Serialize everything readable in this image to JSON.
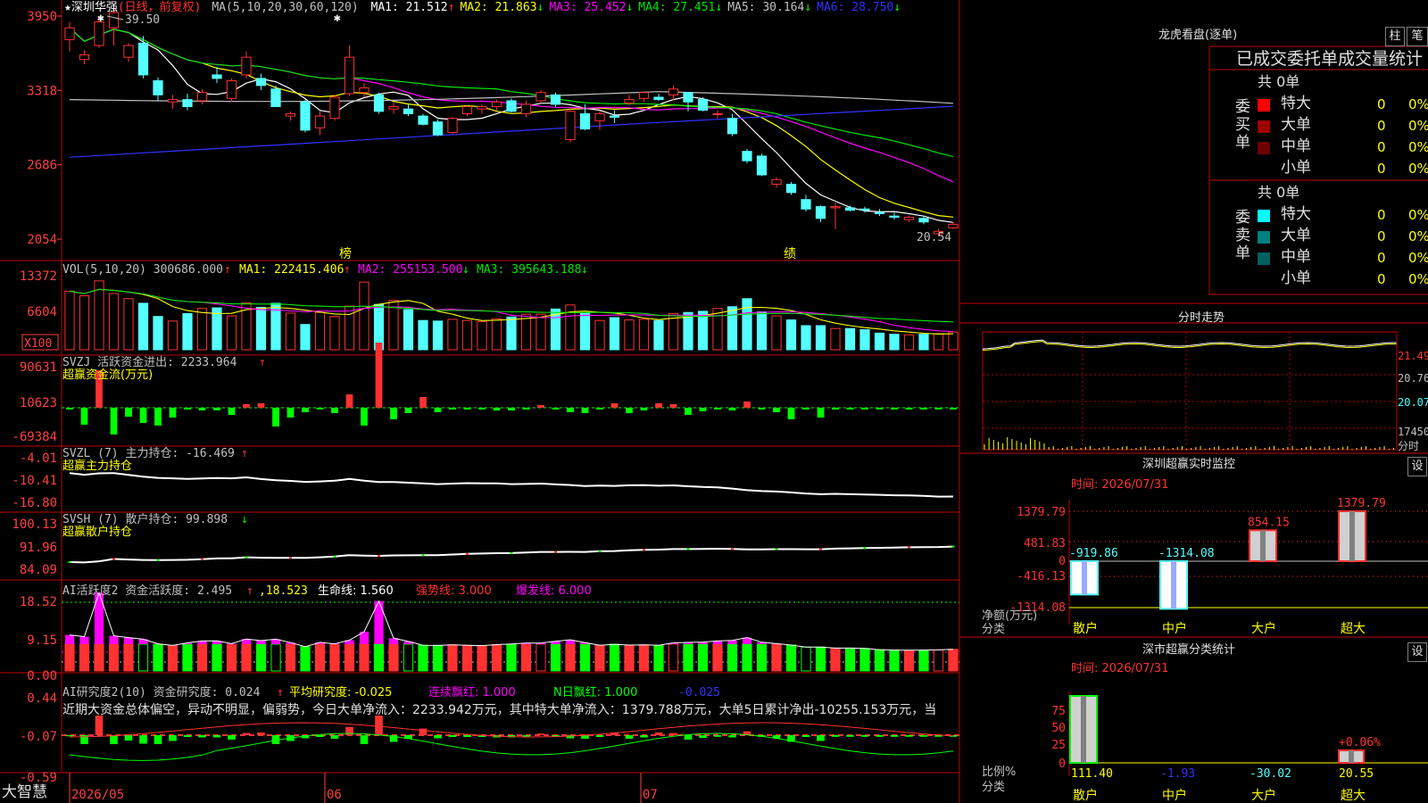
{
  "colors": {
    "up": "#ff3232",
    "down": "#54ffff",
    "ma1": "#ffffff",
    "ma2": "#ffff00",
    "ma3": "#ff00ff",
    "ma4": "#00e600",
    "ma5": "#c0c0c0",
    "ma6": "#3232ff",
    "border": "#c00000",
    "axis": "#ff4040",
    "yellow": "#ffff00",
    "green": "#00ff00"
  },
  "main": {
    "title": "★深圳华强",
    "subtitle": "(日线，前复权)",
    "ma_label": "MA(5,10,20,30,60,120)",
    "ma": [
      {
        "label": "MA1: 21.512",
        "arrow": "↑",
        "color": "#ffffff"
      },
      {
        "label": "MA2: 21.863",
        "arrow": "↓",
        "color": "#ffff00"
      },
      {
        "label": "MA3: 25.452",
        "arrow": "↓",
        "color": "#ff00ff"
      },
      {
        "label": "MA4: 27.451",
        "arrow": "↓",
        "color": "#00e600"
      },
      {
        "label": "MA5: 30.164",
        "arrow": "↓",
        "color": "#c0c0c0"
      },
      {
        "label": "MA6: 28.750",
        "arrow": "↓",
        "color": "#3232ff"
      }
    ],
    "y_ticks": [
      "3950",
      "3318",
      "2686",
      "2054"
    ],
    "high_label": "39.50",
    "low_label": "20.54",
    "markers": [
      "榜",
      "绩"
    ],
    "star_marks": [
      "✱",
      "✱"
    ]
  },
  "chart_data": [
    {
      "type": "candlestick",
      "title": "★深圳华强(日线，前复权)",
      "ylim": [
        1900,
        4000
      ],
      "y_ticks": [
        3950,
        3318,
        2686,
        2054
      ],
      "x_ticks": [
        "2026/05",
        "06",
        "07"
      ],
      "ohlc": [
        [
          3750,
          3900,
          3650,
          3850
        ],
        [
          3580,
          3660,
          3540,
          3620
        ],
        [
          3700,
          3950,
          3680,
          3900
        ],
        [
          3850,
          4020,
          3700,
          3980
        ],
        [
          3600,
          3720,
          3560,
          3700
        ],
        [
          3720,
          3780,
          3420,
          3450
        ],
        [
          3400,
          3430,
          3230,
          3280
        ],
        [
          3220,
          3280,
          3160,
          3240
        ],
        [
          3240,
          3290,
          3150,
          3180
        ],
        [
          3230,
          3330,
          3200,
          3300
        ],
        [
          3450,
          3520,
          3380,
          3420
        ],
        [
          3250,
          3420,
          3220,
          3400
        ],
        [
          3450,
          3650,
          3420,
          3600
        ],
        [
          3420,
          3460,
          3320,
          3360
        ],
        [
          3330,
          3360,
          3180,
          3180
        ],
        [
          3100,
          3140,
          3060,
          3120
        ],
        [
          3220,
          3240,
          2960,
          2980
        ],
        [
          3000,
          3140,
          2940,
          3100
        ],
        [
          3080,
          3280,
          3060,
          3260
        ],
        [
          3290,
          3700,
          3270,
          3600
        ],
        [
          3300,
          3380,
          3260,
          3340
        ],
        [
          3280,
          3300,
          3120,
          3140
        ],
        [
          3160,
          3220,
          3120,
          3180
        ],
        [
          3160,
          3200,
          3100,
          3120
        ],
        [
          3100,
          3120,
          3020,
          3030
        ],
        [
          3050,
          3070,
          2930,
          2940
        ],
        [
          2960,
          3090,
          2950,
          3080
        ],
        [
          3120,
          3190,
          3100,
          3180
        ],
        [
          3160,
          3200,
          3120,
          3180
        ],
        [
          3180,
          3240,
          3150,
          3220
        ],
        [
          3230,
          3250,
          3130,
          3140
        ],
        [
          3120,
          3230,
          3090,
          3200
        ],
        [
          3230,
          3320,
          3210,
          3300
        ],
        [
          3280,
          3300,
          3180,
          3200
        ],
        [
          2900,
          3160,
          2880,
          3140
        ],
        [
          3120,
          3200,
          2980,
          2990
        ],
        [
          3060,
          3140,
          2980,
          3120
        ],
        [
          3100,
          3150,
          3040,
          3090
        ],
        [
          3210,
          3280,
          3190,
          3240
        ],
        [
          3250,
          3310,
          3220,
          3300
        ],
        [
          3260,
          3290,
          3230,
          3240
        ],
        [
          3280,
          3360,
          3230,
          3330
        ],
        [
          3300,
          3260,
          3140,
          3220
        ],
        [
          3240,
          3260,
          3140,
          3150
        ],
        [
          3120,
          3150,
          3080,
          3120
        ],
        [
          3080,
          3120,
          2930,
          2950
        ],
        [
          2800,
          2820,
          2700,
          2720
        ],
        [
          2760,
          2780,
          2590,
          2600
        ],
        [
          2520,
          2580,
          2490,
          2560
        ],
        [
          2520,
          2540,
          2430,
          2450
        ],
        [
          2390,
          2430,
          2290,
          2310
        ],
        [
          2330,
          2340,
          2200,
          2230
        ],
        [
          2320,
          2360,
          2140,
          2330
        ],
        [
          2320,
          2340,
          2290,
          2300
        ],
        [
          2310,
          2330,
          2280,
          2300
        ],
        [
          2280,
          2310,
          2250,
          2270
        ],
        [
          2250,
          2280,
          2220,
          2240
        ],
        [
          2220,
          2250,
          2200,
          2240
        ],
        [
          2230,
          2250,
          2180,
          2200
        ],
        [
          2100,
          2140,
          2080,
          2120
        ],
        [
          2150,
          2200,
          2140,
          2180
        ]
      ]
    },
    {
      "type": "bar",
      "title": "VOL(5,10,20)",
      "ylim": [
        0,
        13372
      ],
      "values": [
        10200,
        9400,
        12000,
        9800,
        8900,
        8100,
        5800,
        5000,
        6300,
        7200,
        7300,
        5900,
        8200,
        7400,
        8100,
        6400,
        4400,
        6500,
        5800,
        7600,
        11800,
        7900,
        8600,
        7000,
        5100,
        5000,
        5300,
        5100,
        4900,
        5400,
        5700,
        6200,
        6200,
        7100,
        7800,
        6400,
        5100,
        5600,
        5200,
        5300,
        5100,
        6300,
        6500,
        6700,
        7200,
        7500,
        8900,
        6600,
        5900,
        5200,
        4200,
        4200,
        3700,
        3700,
        3500,
        2900,
        2700,
        2600,
        2700,
        2800,
        3100
      ]
    },
    {
      "type": "bar",
      "title": "超赢资金流(万元)",
      "ylim": [
        -69384,
        90631
      ],
      "values": [
        -500,
        -19000,
        42000,
        -30000,
        -10000,
        -17000,
        -20000,
        -11000,
        -2000,
        -3000,
        -3000,
        -8000,
        4000,
        5000,
        -21000,
        -11000,
        -5000,
        -2000,
        -6000,
        15000,
        -20000,
        73000,
        -13000,
        -6000,
        12000,
        -5000,
        -2000,
        -2000,
        -2000,
        -3000,
        -3000,
        -2000,
        3000,
        -2000,
        -5000,
        -6000,
        -2000,
        5000,
        -6000,
        -3000,
        5000,
        4000,
        -8000,
        -4000,
        -1500,
        -3000,
        7000,
        -1500,
        -5000,
        -13000,
        -2000,
        -11000,
        -1500,
        -1500,
        -1500,
        -1500,
        -1500,
        -1500,
        -1500,
        -1500,
        -1500
      ]
    }
  ],
  "panels": {
    "vol": {
      "text": "VOL(5,10,20) 300686.000",
      "arrow": "↑",
      "ma": [
        {
          "label": "MA1: 222415.406",
          "arrow": "↑",
          "color": "#ffff00"
        },
        {
          "label": "MA2: 255153.500",
          "arrow": "↓",
          "color": "#ff00ff"
        },
        {
          "label": "MA3: 395643.188",
          "arrow": "↓",
          "color": "#00e600"
        }
      ],
      "y_ticks": [
        "13372",
        "6604"
      ],
      "unit": "X100"
    },
    "svzj": {
      "text": "SVZJ  活跃资金进出: 2233.964",
      "arrow": "↑",
      "sub": "超赢资金流(万元)",
      "y_ticks": [
        "90631",
        "10623",
        "-69384"
      ]
    },
    "svzl": {
      "text": "SVZL (7) 主力持仓: -16.469",
      "arrow": "↑",
      "sub": "超赢主力持仓",
      "y_ticks": [
        "-4.01",
        "-10.41",
        "-16.80"
      ]
    },
    "svsh": {
      "text": "SVSH (7) 散户持仓: 99.898",
      "arrow": "↓",
      "sub": "超赢散户持仓",
      "y_ticks": [
        "100.13",
        "91.96",
        "84.09"
      ]
    },
    "ai1": {
      "text": "AI活跃度2 资金活跃度: 2.495",
      "arrow": "↑",
      "v2": "18.523",
      "life": "生命线: 1.560",
      "strong": "强势线: 3.000",
      "burst": "爆发线: 6.000",
      "y_ticks": [
        "18.52",
        "9.15",
        "0.00"
      ]
    },
    "ai2": {
      "text": "AI研究度2(10) 资金研究度: 0.024",
      "arrow": "↑",
      "avg": "平均研究度: -0.025",
      "red": "连续飘红: 1.000",
      "nred": "N日飘红: 1.000",
      "last": "-0.025",
      "y_ticks": [
        "0.44",
        "-0.07",
        "-0.59"
      ],
      "note": "近期大资金总体偏空，异动不明显，偏弱势，今日大单净流入：2233.942万元，其中特大单净流入：1379.788万元，大单5日累计净出-10255.153万元，当"
    }
  },
  "bottom": {
    "brand": "大智慧",
    "dates": [
      "2026/05",
      "06",
      "07"
    ]
  },
  "right": {
    "dragon": {
      "title": "龙虎看盘(逐单)",
      "btn1": "柱",
      "btn2": "笔",
      "header": "已成交委托单成交量统计",
      "buy": {
        "vert": [
          "委",
          "买",
          "单"
        ],
        "total": "共 0单",
        "rows": [
          {
            "label": "特大",
            "val": "0",
            "pct": "0%",
            "color": "#ff0000"
          },
          {
            "label": "大单",
            "val": "0",
            "pct": "0%",
            "color": "#a00000"
          },
          {
            "label": "中单",
            "val": "0",
            "pct": "0%",
            "color": "#700000"
          },
          {
            "label": "小单",
            "val": "0",
            "pct": "0%",
            "color": ""
          }
        ]
      },
      "sell": {
        "vert": [
          "委",
          "卖",
          "单"
        ],
        "total": "共 0单",
        "rows": [
          {
            "label": "特大",
            "val": "0",
            "pct": "0%",
            "color": "#00ffff"
          },
          {
            "label": "大单",
            "val": "0",
            "pct": "0%",
            "color": "#008080"
          },
          {
            "label": "中单",
            "val": "0",
            "pct": "0%",
            "color": "#006060"
          },
          {
            "label": "小单",
            "val": "0",
            "pct": "0%",
            "color": ""
          }
        ]
      }
    },
    "intraday": {
      "title": "分时走势",
      "y_ticks": [
        "21.49",
        "20.76",
        "20.07",
        "17450",
        "分时"
      ]
    },
    "sz_monitor": {
      "title": "深圳超赢实时监控",
      "btn": "设",
      "time": "时间: 2026/07/31",
      "y_ticks": [
        "1379.79",
        "481.83",
        "0",
        "-416.13",
        "-1314.08"
      ],
      "ylabel": "净额(万元)",
      "xlabel": "分类",
      "cats": [
        "散户",
        "中户",
        "大户",
        "超大"
      ],
      "values": [
        -919.86,
        -1314.08,
        854.15,
        1379.79
      ],
      "labels": [
        "-919.86",
        "-1314.08",
        "854.15",
        "1379.79"
      ]
    },
    "sz_class": {
      "title": "深市超赢分类统计",
      "btn": "设",
      "time": "时间: 2026/07/31",
      "y_ticks": [
        "75",
        "50",
        "25",
        "0"
      ],
      "ylabel": "比例%",
      "xlabel": "分类",
      "cats": [
        "散户",
        "中户",
        "大户",
        "超大"
      ],
      "values": [
        "111.40",
        "-1.93",
        "-30.02",
        "20.55"
      ],
      "bar_label": "+0.06%"
    }
  }
}
